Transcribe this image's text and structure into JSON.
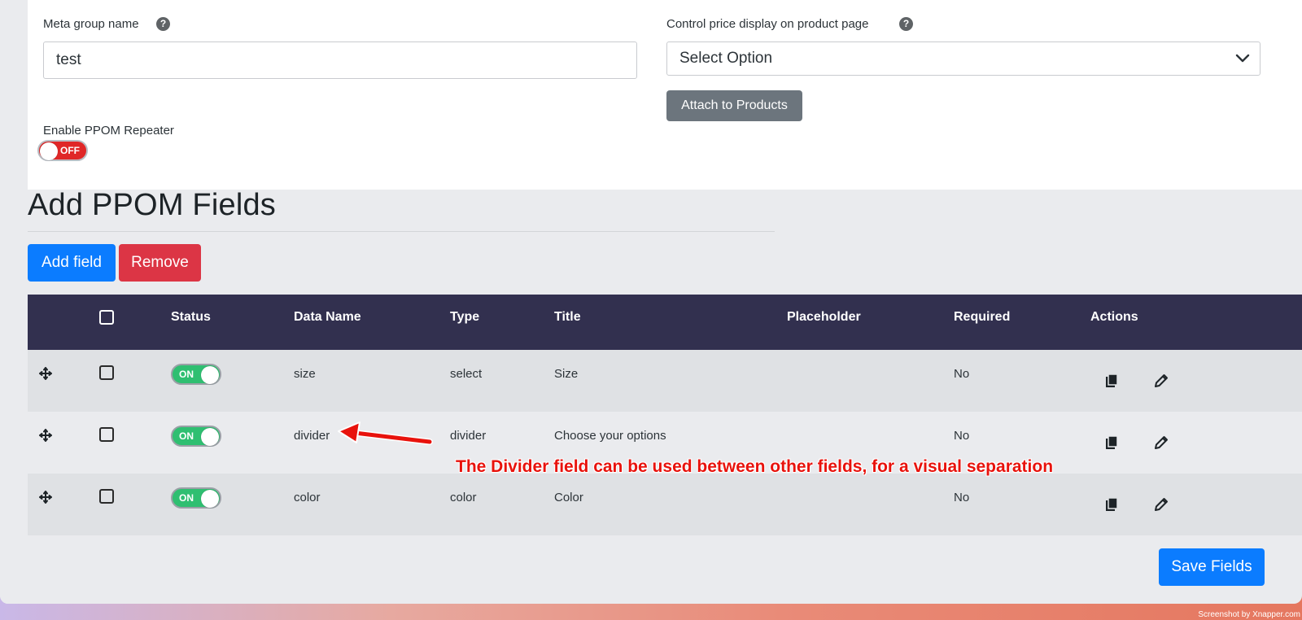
{
  "meta": {
    "group_name_label": "Meta group name",
    "group_name_value": "test",
    "price_display_label": "Control price display on product page",
    "price_display_selected": "Select Option",
    "attach_button": "Attach to Products",
    "repeater_label": "Enable PPOM Repeater",
    "repeater_toggle": "OFF",
    "help_glyph": "?"
  },
  "section": {
    "title": "Add PPOM Fields",
    "add_button": "Add field",
    "remove_button": "Remove"
  },
  "table": {
    "headers": {
      "status": "Status",
      "data_name": "Data Name",
      "type": "Type",
      "title": "Title",
      "placeholder": "Placeholder",
      "required": "Required",
      "actions": "Actions"
    },
    "rows": [
      {
        "status": "ON",
        "data_name": "size",
        "type": "select",
        "title": "Size",
        "placeholder": "",
        "required": "No"
      },
      {
        "status": "ON",
        "data_name": "divider",
        "type": "divider",
        "title": "Choose your options",
        "placeholder": "",
        "required": "No"
      },
      {
        "status": "ON",
        "data_name": "color",
        "type": "color",
        "title": "Color",
        "placeholder": "",
        "required": "No"
      }
    ]
  },
  "annotation": {
    "text": "The Divider field can be used between other fields, for a visual separation",
    "color": "#e8120c"
  },
  "save_button": "Save Fields",
  "credit": "Screenshot by Xnapper.com",
  "colors": {
    "primary": "#0b7cff",
    "danger": "#dc3545",
    "table_header": "#32304f",
    "toggle_on": "#2fbf71",
    "toggle_off": "#e02727"
  }
}
